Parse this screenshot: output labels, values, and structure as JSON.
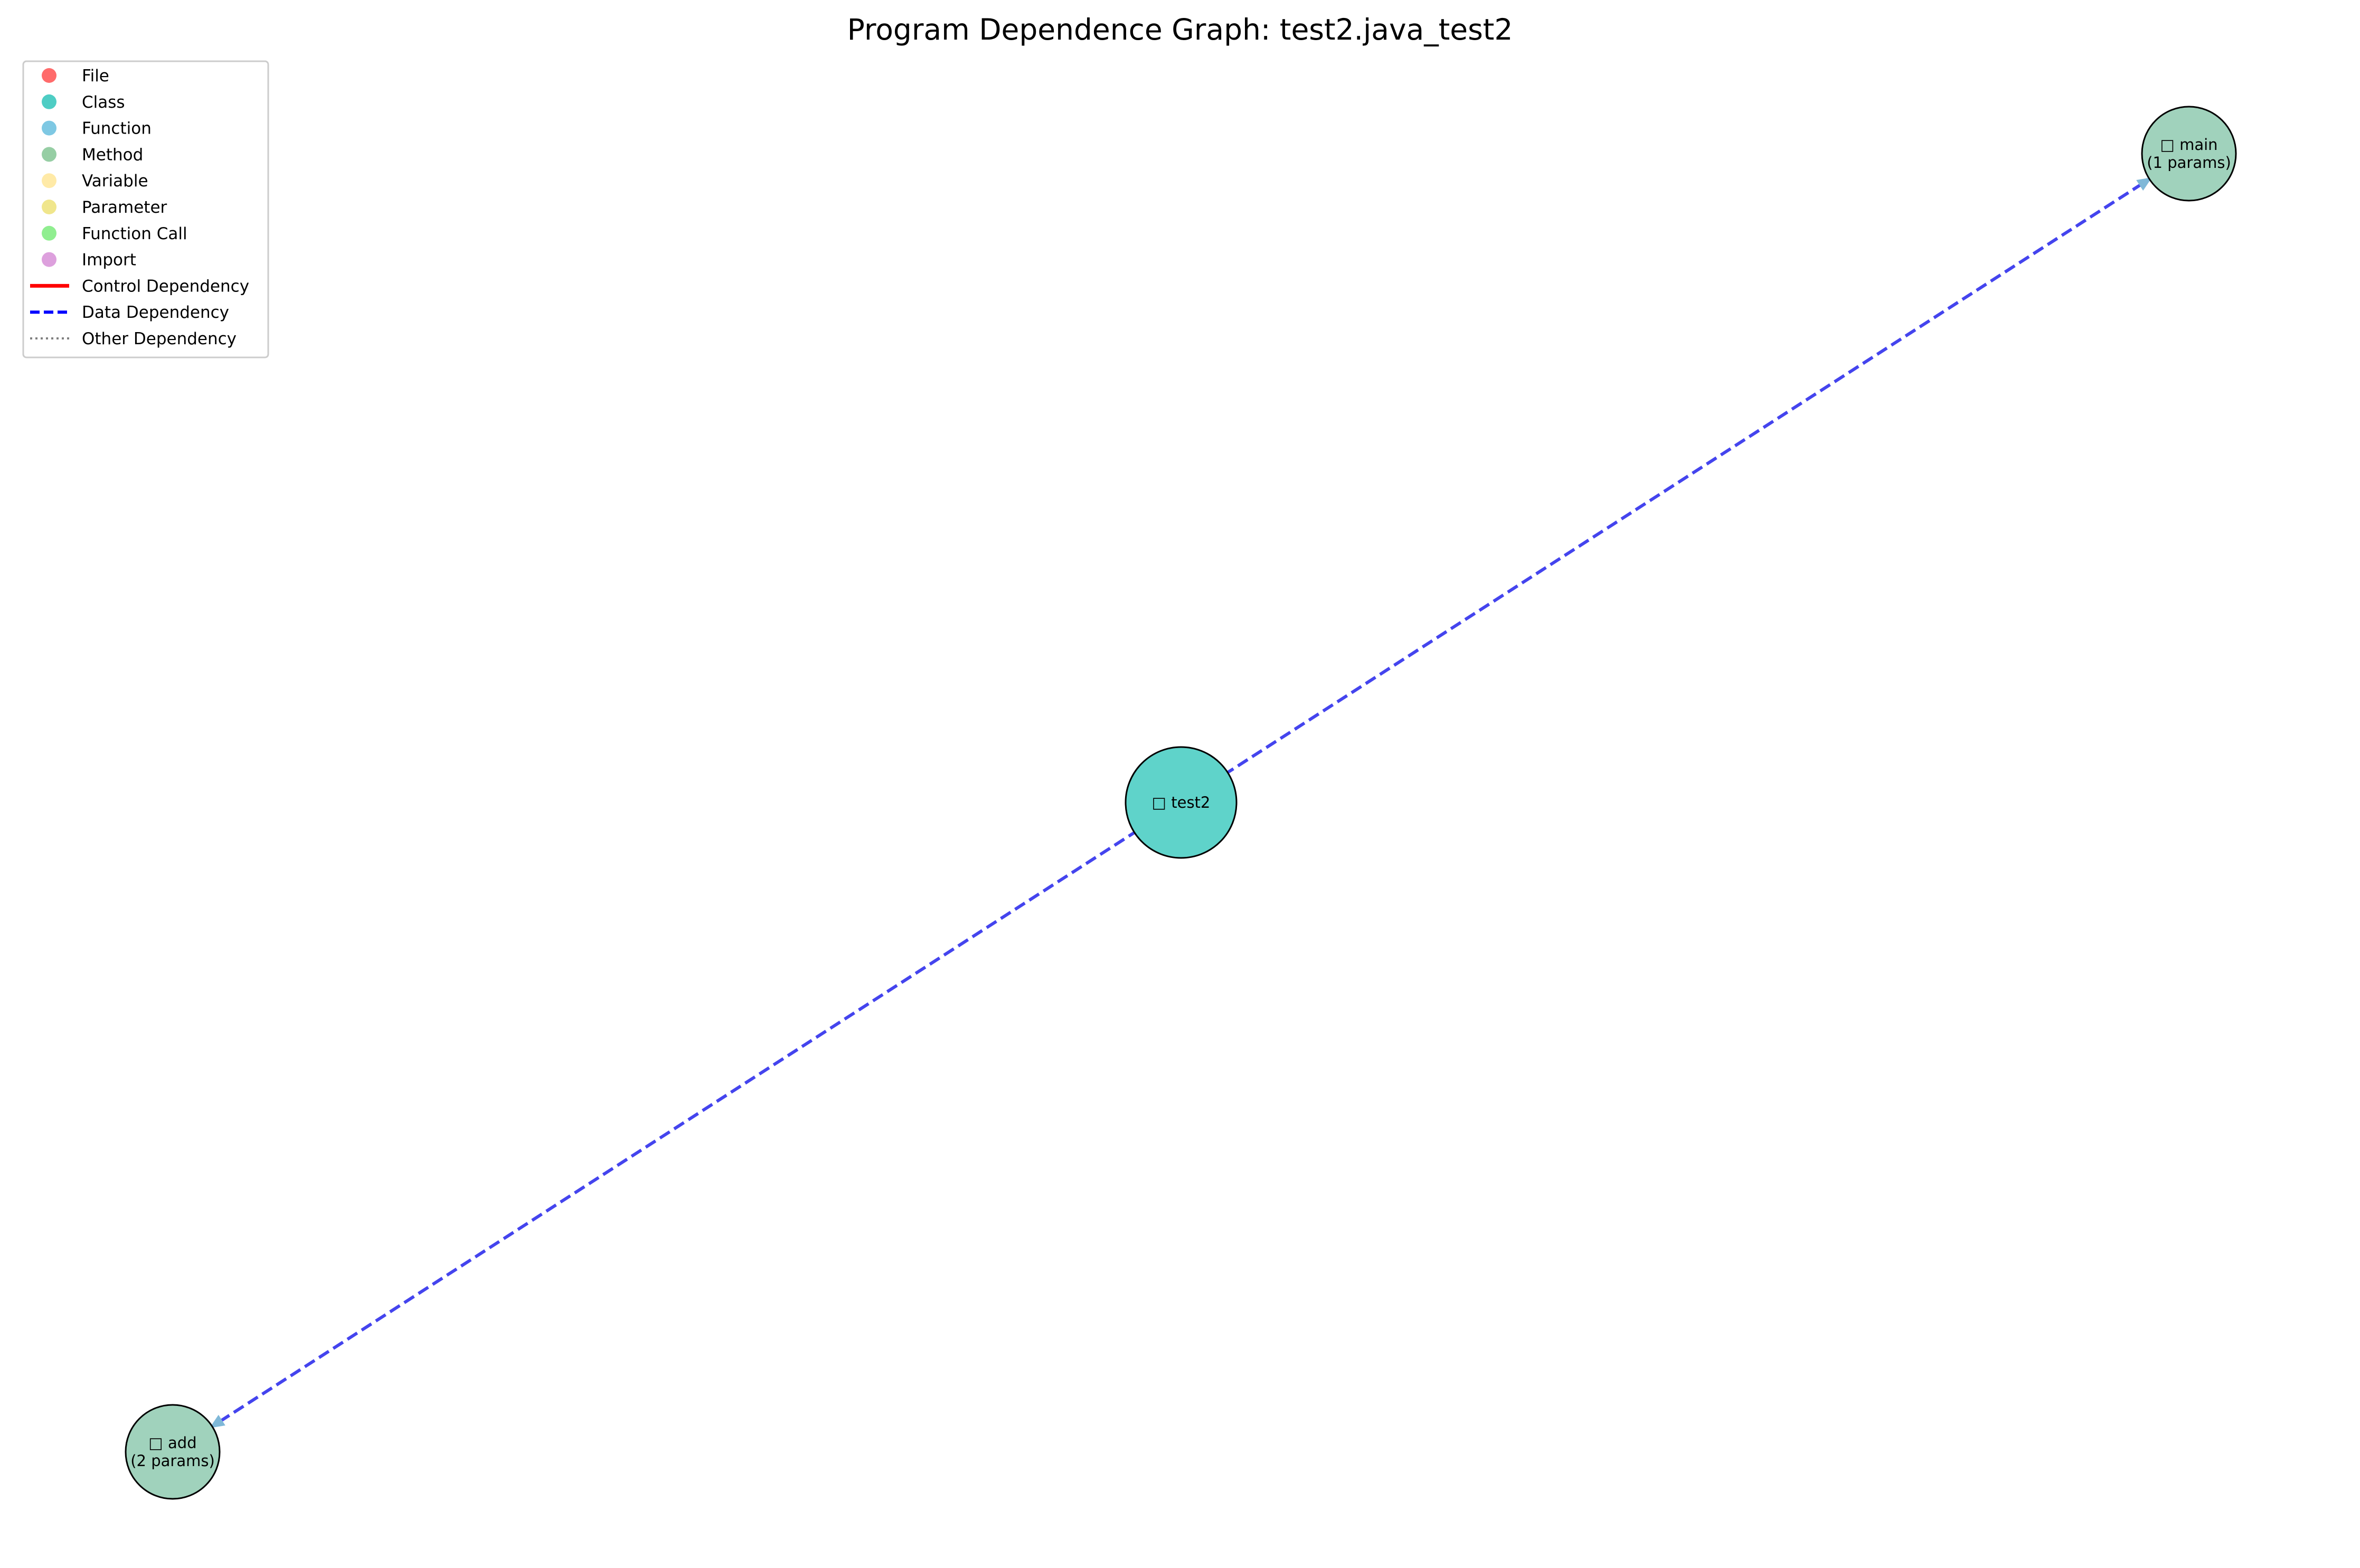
{
  "title": "Program Dependence Graph: test2.java_test2",
  "legend": {
    "placement": "upper-left",
    "entries": [
      {
        "label": "File",
        "kind": "marker",
        "color": "#ff6b6b"
      },
      {
        "label": "Class",
        "kind": "marker",
        "color": "#4ecdc4"
      },
      {
        "label": "Function",
        "kind": "marker",
        "color": "#7ec8e3"
      },
      {
        "label": "Method",
        "kind": "marker",
        "color": "#96cea4"
      },
      {
        "label": "Variable",
        "kind": "marker",
        "color": "#ffeaa7"
      },
      {
        "label": "Parameter",
        "kind": "marker",
        "color": "#f0e68c"
      },
      {
        "label": "Function Call",
        "kind": "marker",
        "color": "#90ee90"
      },
      {
        "label": "Import",
        "kind": "marker",
        "color": "#dda0dd"
      },
      {
        "label": "Control Dependency",
        "kind": "line",
        "style": "solid",
        "color": "#ff0000"
      },
      {
        "label": "Data Dependency",
        "kind": "line",
        "style": "dashed",
        "color": "#0000ff"
      },
      {
        "label": "Other Dependency",
        "kind": "line",
        "style": "dotted",
        "color": "#808080"
      }
    ]
  },
  "nodes": [
    {
      "id": "test2",
      "type": "Class",
      "label_lines": [
        "□ test2"
      ],
      "color": "#5fd3ca",
      "size": "large"
    },
    {
      "id": "main",
      "type": "Method",
      "label_lines": [
        "□ main",
        "(1 params)"
      ],
      "color": "#a0d2bc",
      "size": "small"
    },
    {
      "id": "add",
      "type": "Method",
      "label_lines": [
        "□ add",
        "(2 params)"
      ],
      "color": "#a0d2bc",
      "size": "small"
    }
  ],
  "edges": [
    {
      "from": "test2",
      "to": "main",
      "type": "Data Dependency",
      "color": "#4444ee"
    },
    {
      "from": "test2",
      "to": "add",
      "type": "Data Dependency",
      "color": "#4444ee"
    }
  ]
}
